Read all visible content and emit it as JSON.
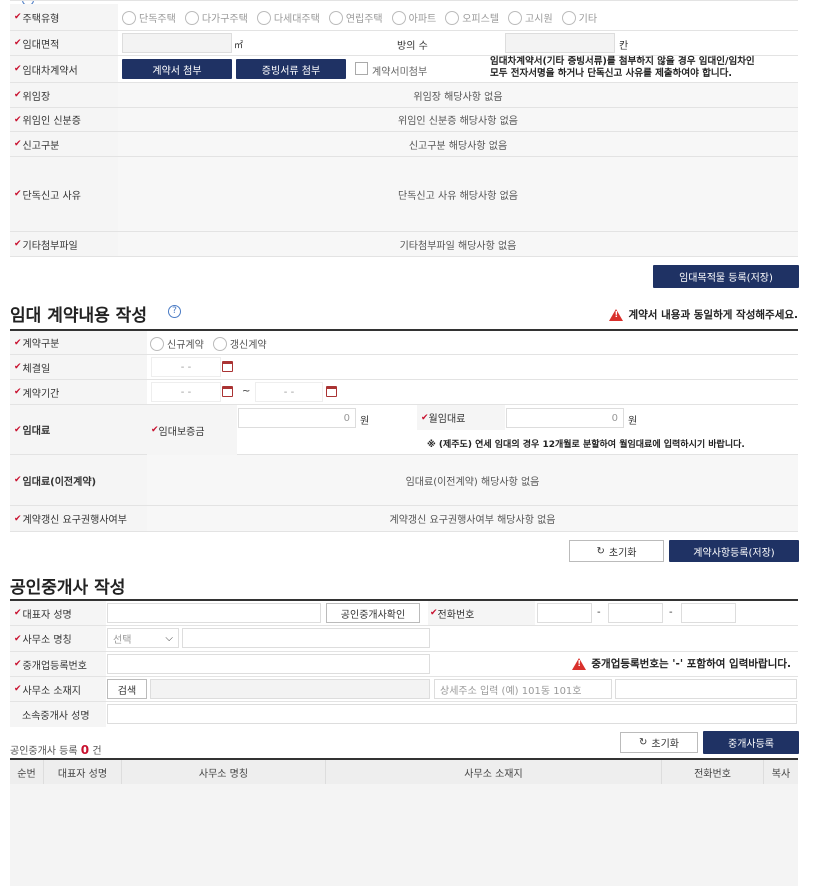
{
  "housing": {
    "type_label": "주택유형",
    "types": [
      "단독주택",
      "다가구주택",
      "다세대주택",
      "연립주택",
      "아파트",
      "오피스텔",
      "고시원",
      "기타"
    ],
    "area_label": "임대면적",
    "area_unit": "㎡",
    "rooms_label": "방의 수",
    "rooms_unit": "칸",
    "contract_label": "임대차계약서",
    "attach_contract": "계약서 첨부",
    "attach_proof": "증빙서류 첨부",
    "no_attach": "계약서미첨부",
    "notice_line1": "임대차계약서(기타 증빙서류)를 첨부하지 않을 경우 임대인/임차인",
    "notice_line2": "모두 전자서명을 하거나 단독신고 사유를 제출하여야 합니다.",
    "delegation_label": "위임장",
    "delegation_na": "위임장 해당사항 없음",
    "delegate_id_label": "위임인 신분증",
    "delegate_id_na": "위임인 신분증 해당사항 없음",
    "report_type_label": "신고구분",
    "report_type_na": "신고구분 해당사항 없음",
    "single_reason_label": "단독신고 사유",
    "single_reason_na": "단독신고 사유 해당사항 없음",
    "etc_file_label": "기타첨부파일",
    "etc_file_na": "기타첨부파일 해당사항 없음",
    "register_button": "임대목적물 등록(저장)"
  },
  "contract": {
    "title": "임대 계약내용 작성",
    "warning": "계약서 내용과 동일하게 작성해주세요.",
    "type_label": "계약구분",
    "new_label": "신규계약",
    "renew_label": "갱신계약",
    "sign_date_label": "체결일",
    "period_label": "계약기간",
    "date_placeholder": "-   -",
    "tilde": "~",
    "rent_label": "임대료",
    "deposit_label": "임대보증금",
    "deposit_value": "0",
    "won": "원",
    "monthly_label": "월임대료",
    "monthly_value": "0",
    "jeju_notice": "※ (제주도) 연세 임대의 경우 12개월로 분할하여 월임대료에 입력하시기 바랍니다.",
    "prev_rent_label": "임대료(이전계약)",
    "prev_rent_na": "임대료(이전계약) 해당사항 없음",
    "renewal_right_label": "계약갱신 요구권행사여부",
    "renewal_right_na": "계약갱신 요구권행사여부 해당사항 없음",
    "reset_button": "초기화",
    "save_button": "계약사항등록(저장)"
  },
  "broker": {
    "title": "공인중개사 작성",
    "rep_name_label": "대표자 성명",
    "verify_button": "공인중개사확인",
    "phone_label": "전화번호",
    "dash": "-",
    "office_name_label": "사무소 명칭",
    "select_placeholder": "선택",
    "reg_no_label": "중개업등록번호",
    "reg_warning": "중개업등록번호는 '-' 포함하여 입력바랍니다.",
    "address_label": "사무소 소재지",
    "search_button": "검색",
    "detail_placeholder": "상세주소 입력 (예) 101동 101호",
    "agent_name_label": "소속중개사 성명",
    "count_prefix": "공인중개사 등록",
    "count": "0",
    "count_suffix": "건",
    "reset_button": "초기화",
    "register_button": "중개사등록",
    "columns": [
      "순번",
      "대표자 성명",
      "사무소 명칭",
      "사무소 소재지",
      "전화번호",
      "복사"
    ]
  }
}
